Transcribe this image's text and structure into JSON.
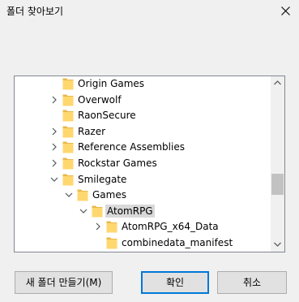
{
  "window": {
    "title": "폴더 찾아보기"
  },
  "tree": {
    "items": [
      {
        "label": "Origin Games",
        "expander": "none",
        "selected": false
      },
      {
        "label": "Overwolf",
        "expander": "collapsed",
        "selected": false
      },
      {
        "label": "RaonSecure",
        "expander": "none",
        "selected": false
      },
      {
        "label": "Razer",
        "expander": "collapsed",
        "selected": false
      },
      {
        "label": "Reference Assemblies",
        "expander": "collapsed",
        "selected": false
      },
      {
        "label": "Rockstar Games",
        "expander": "collapsed",
        "selected": false
      },
      {
        "label": "Smilegate",
        "expander": "expanded",
        "selected": false
      },
      {
        "label": "Games",
        "expander": "expanded",
        "selected": false
      },
      {
        "label": "AtomRPG",
        "expander": "expanded",
        "selected": true
      },
      {
        "label": "AtomRPG_x64_Data",
        "expander": "collapsed",
        "selected": false
      },
      {
        "label": "combinedata_manifest",
        "expander": "none",
        "selected": false
      }
    ]
  },
  "buttons": {
    "new_folder": "새 폴더 만들기(M)",
    "ok": "확인",
    "cancel": "취소"
  },
  "colors": {
    "folder_fill": "#ffd76f",
    "folder_tab": "#e8b94a",
    "selection": "#d9d9d9",
    "default_button_border": "#0078d7"
  }
}
